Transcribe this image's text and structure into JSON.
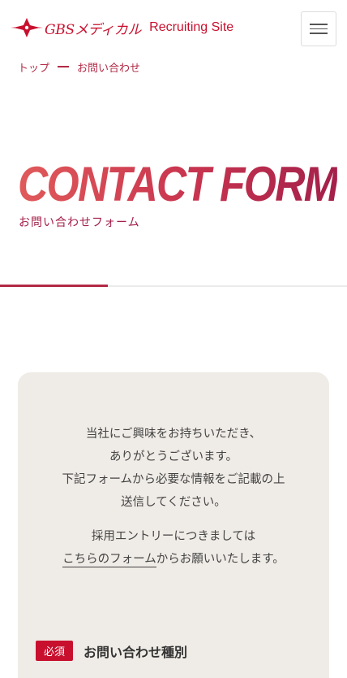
{
  "header": {
    "brand": "GBSメディカル",
    "site": "Recruiting Site",
    "menu_icon": "hamburger-icon",
    "logo_icon": "star-cross-logo-icon"
  },
  "breadcrumb": {
    "home": "トップ",
    "current": "お問い合わせ"
  },
  "hero": {
    "title": "CONTACT FORM",
    "subtitle": "お問い合わせフォーム",
    "progress_fraction": 0.31
  },
  "intro": {
    "line1": "当社にご興味をお持ちいただき、",
    "line2": "ありがとうございます。",
    "line3": "下記フォームから必要な情報をご記載の上",
    "line4": "送信してください。"
  },
  "entry": {
    "line1": "採用エントリーにつきましては",
    "link": "こちらのフォーム",
    "line2_rest": "からお願いいたします。"
  },
  "form": {
    "required_badge": "必須",
    "field_label": "お問い合わせ種別"
  },
  "colors": {
    "brand": "#c8102e",
    "accent": "#b22a45",
    "card_bg": "#efebe6"
  }
}
